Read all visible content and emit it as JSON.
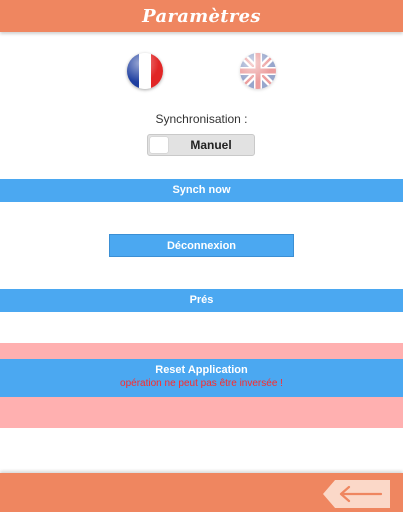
{
  "header": {
    "title": "Paramètres"
  },
  "languages": [
    {
      "name": "france-flag-icon"
    },
    {
      "name": "uk-flag-icon"
    }
  ],
  "sync": {
    "label": "Synchronisation :",
    "mode": "Manuel"
  },
  "buttons": {
    "synch_now": "Synch now",
    "logout": "Déconnexion",
    "pres": "Prés",
    "reset": "Reset Application",
    "reset_warning": "opération ne peut pas être inversée !"
  },
  "footer": {
    "back_icon": "arrow-left-icon"
  },
  "colors": {
    "header": "#ef8660",
    "button": "#4ba8f1",
    "reset_band": "#ffb0b0",
    "warning": "#ff2a2a"
  }
}
